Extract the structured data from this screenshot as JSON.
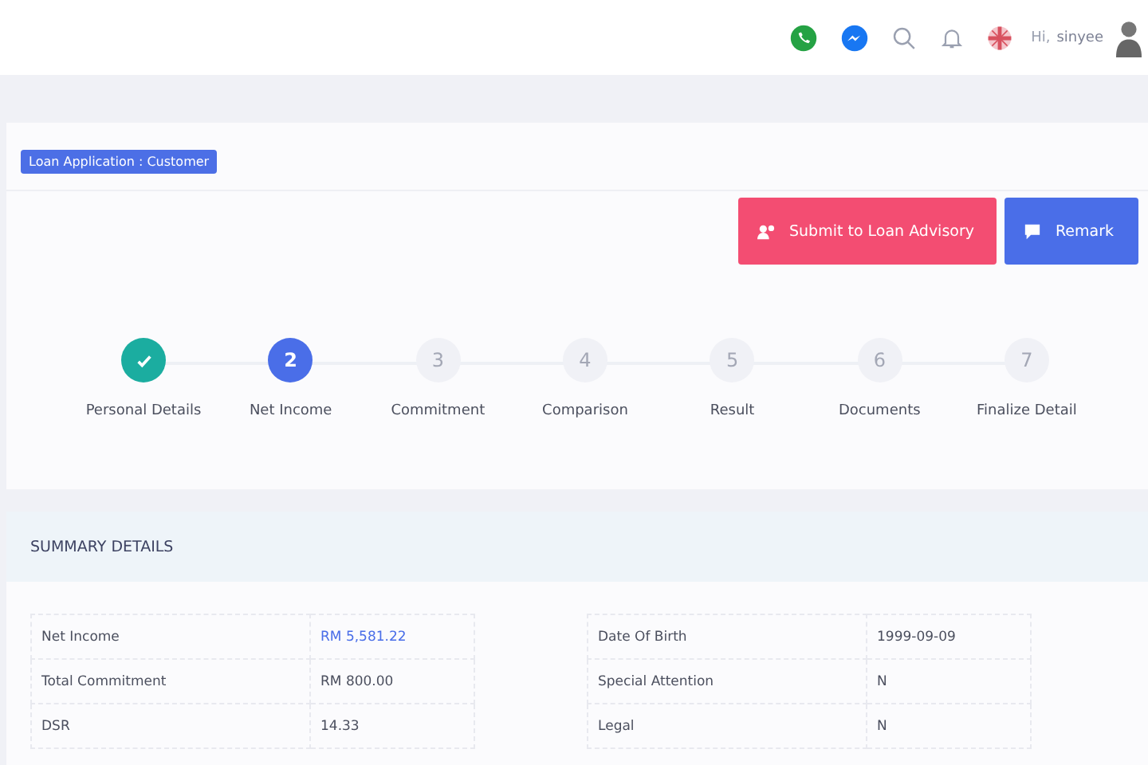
{
  "header": {
    "greeting": "Hi,",
    "user": "sinyee"
  },
  "page": {
    "badge": "Loan Application : Customer",
    "actions": [
      {
        "label": "Submit to Loan Advisory",
        "kind": "submit"
      },
      {
        "label": "Remark",
        "kind": "remark"
      }
    ]
  },
  "steps": [
    {
      "label": "Personal Details",
      "completed": true,
      "selected": false
    },
    {
      "number": "2",
      "label": "Net Income",
      "completed": false,
      "selected": true
    },
    {
      "number": "3",
      "label": "Commitment",
      "completed": false,
      "selected": false
    },
    {
      "number": "4",
      "label": "Comparison",
      "completed": false,
      "selected": false
    },
    {
      "number": "5",
      "label": "Result",
      "completed": false,
      "selected": false
    },
    {
      "number": "6",
      "label": "Documents",
      "completed": false,
      "selected": false
    },
    {
      "number": "7",
      "label": "Finalize Detail",
      "completed": false,
      "selected": false
    }
  ],
  "summary": {
    "title": "SUMMARY DETAILS",
    "tables": [
      {
        "rows": [
          {
            "label": "Net Income",
            "value": "RM 5,581.22",
            "link": true
          },
          {
            "label": "Total Commitment",
            "value": "RM 800.00",
            "link": false
          },
          {
            "label": "DSR",
            "value": "14.33",
            "link": false
          }
        ]
      },
      {
        "rows": [
          {
            "label": "Date Of Birth",
            "value": "1999-09-09",
            "link": false
          },
          {
            "label": "Special Attention",
            "value": "N",
            "link": false
          },
          {
            "label": "Legal",
            "value": "N",
            "link": false
          }
        ]
      }
    ]
  }
}
